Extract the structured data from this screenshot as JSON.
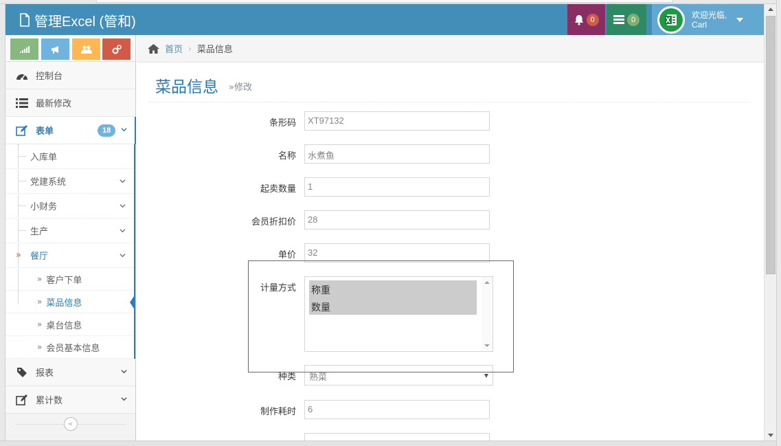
{
  "navbar": {
    "brand": "管理Excel (管和)",
    "bell_count": "0",
    "tasks_count": "0",
    "welcome_line1": "欢迎光临,",
    "welcome_line2": "Carl",
    "bell_color": "#892e65",
    "tasks_color": "#2e8965",
    "bar_color": "#438eb9"
  },
  "sidebar": {
    "shortcuts": [
      {
        "icon": "signal-icon",
        "color": "#87b87f"
      },
      {
        "icon": "bullhorn-icon",
        "color": "#6fb3e0"
      },
      {
        "icon": "users-icon",
        "color": "#ffb752"
      },
      {
        "icon": "cogs-icon",
        "color": "#d15b47"
      }
    ],
    "items": [
      {
        "label": "控制台",
        "icon": "dashboard-icon"
      },
      {
        "label": "最新修改",
        "icon": "list-icon"
      },
      {
        "label": "表单",
        "icon": "edit-icon",
        "count": "18"
      },
      {
        "label": "报表",
        "icon": "tag-icon"
      },
      {
        "label": "累计数",
        "icon": "edit-icon"
      }
    ],
    "sub_items": [
      {
        "label": "入库单"
      },
      {
        "label": "党建系统"
      },
      {
        "label": "小财务"
      },
      {
        "label": "生产"
      },
      {
        "label": "餐厅"
      }
    ],
    "restaurant_items": [
      {
        "label": "客户下单"
      },
      {
        "label": "菜品信息"
      },
      {
        "label": "桌台信息"
      },
      {
        "label": "会员基本信息"
      }
    ]
  },
  "breadcrumb": {
    "home": "首页",
    "current": "菜品信息"
  },
  "page": {
    "title": "菜品信息",
    "subtitle": "修改"
  },
  "form": {
    "barcode_label": "条形码",
    "barcode_value": "XT97132",
    "name_label": "名称",
    "name_value": "水煮鱼",
    "min_qty_label": "起卖数量",
    "min_qty_value": "1",
    "member_price_label": "会员折扣价",
    "member_price_value": "28",
    "unit_price_label": "单价",
    "unit_price_value": "32",
    "measure_label": "计量方式",
    "measure_options": [
      "称重",
      "数量"
    ],
    "category_label": "种类",
    "category_value": "熟菜",
    "prep_time_label": "制作耗时",
    "prep_time_value": "6"
  }
}
